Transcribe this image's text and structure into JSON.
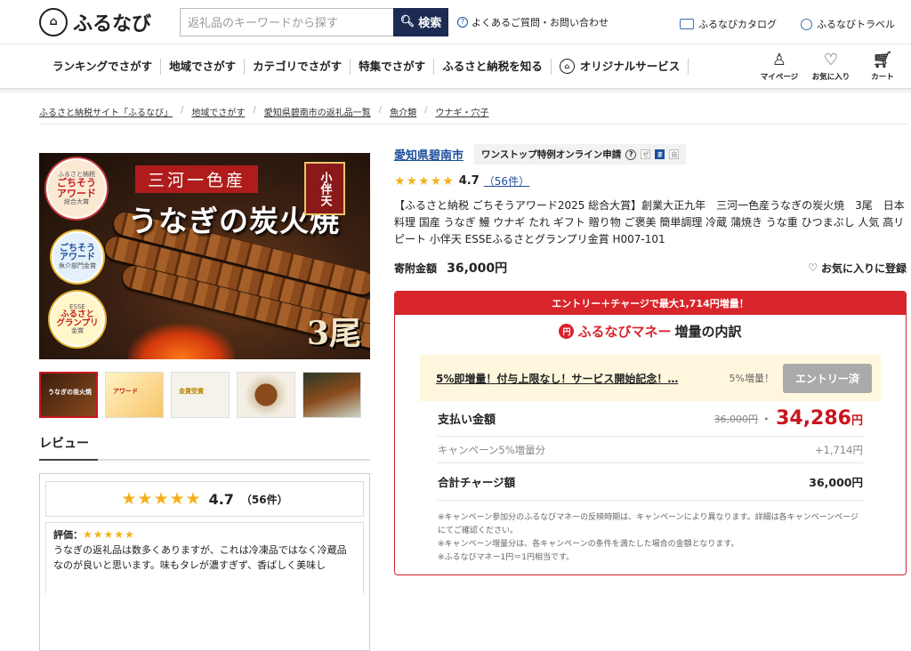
{
  "header": {
    "logo_text": "ふるなび",
    "search_placeholder": "返礼品のキーワードから探す",
    "search_button": "検索",
    "faq_link": "よくあるご質問・お問い合わせ",
    "catalog_link": "ふるなびカタログ",
    "travel_link": "ふるなびトラベル"
  },
  "nav": {
    "items": [
      "ランキングでさがす",
      "地域でさがす",
      "カテゴリでさがす",
      "特集でさがす",
      "ふるさと納税を知る",
      "オリジナルサービス"
    ],
    "mypage": "マイページ",
    "favorites": "お気に入り",
    "cart": "カート"
  },
  "breadcrumb": [
    "ふるさと納税サイト「ふるなび」",
    "地域でさがす",
    "愛知県碧南市の返礼品一覧",
    "魚介類",
    "ウナギ・穴子"
  ],
  "gallery": {
    "main_title_top": "三河一色産",
    "main_title_big": "うなぎの炭火焼",
    "seal_text": "小伴天",
    "count_text": "3尾",
    "badge1": {
      "line1": "ふるさと納税",
      "line2": "ごちそう",
      "line3": "アワード",
      "line4": "総合大賞"
    },
    "badge2": {
      "line1": "ごちそう",
      "line2": "アワード",
      "line3": "魚介部門金賞"
    },
    "badge3": {
      "line1": "ESSE",
      "line2": "ふるさと",
      "line3": "グランプリ",
      "line4": "金賞"
    },
    "thumb_labels": [
      "うなぎの炭火焼",
      "アワード",
      "金賞受賞",
      "",
      ""
    ]
  },
  "review": {
    "section_title": "レビュー",
    "score": "4.7",
    "count": "（56件）",
    "rating_label": "評価：",
    "rating_stars": "★★★★★",
    "text": "うなぎの返礼品は数多くありますが、これは冷凍品ではなく冷蔵品なのが良いと思います。味もタレが濃すぎず、香ばしく美味し"
  },
  "product": {
    "city": "愛知県碧南市",
    "onestop": "ワンストップ特例オンライン申請",
    "chips": [
      "ゼ",
      "ま",
      "自"
    ],
    "score": "4.7",
    "review_count": "（56件）",
    "title": "【ふるさと納税 ごちそうアワード2025 総合大賞】創業大正九年　三河一色産うなぎの炭火焼　3尾　日本料理 国産 うなぎ 鰻 ウナギ たれ ギフト 贈り物 ご褒美 簡単調理 冷蔵 蒲焼き うな重 ひつまぶし 人気 高リピート 小伴天 ESSEふるさとグランプリ金賞 H007-101",
    "price_label": "寄附金額",
    "price": "36,000円",
    "fav_label": "お気に入りに登録"
  },
  "campaign": {
    "banner": "エントリー＋チャージで最大1,714円増量！",
    "title_red": "ふるなびマネー",
    "title_rest": "増量の内訳",
    "coin": "円",
    "promo_text": "5%即増量！付与上限なし！サービス開始記念！…",
    "promo_pct": "5%増量！",
    "promo_button": "エントリー済",
    "pay_label": "支払い金額",
    "pay_old": "36,000円",
    "pay_new": "34,286",
    "pay_unit": "円",
    "bonus_label": "キャンペーン5%増量分",
    "bonus_value": "+1,714円",
    "total_label": "合計チャージ額",
    "total_value": "36,000円",
    "notes": [
      "※キャンペーン参加分のふるなびマネーの反映時期は、キャンペーンにより異なります。詳細は各キャンペーンページにてご確認ください。",
      "※キャンペーン増量分は、各キャンペーンの条件を満たした場合の金額となります。",
      "※ふるなびマネー1円＝1円相当です。"
    ]
  }
}
